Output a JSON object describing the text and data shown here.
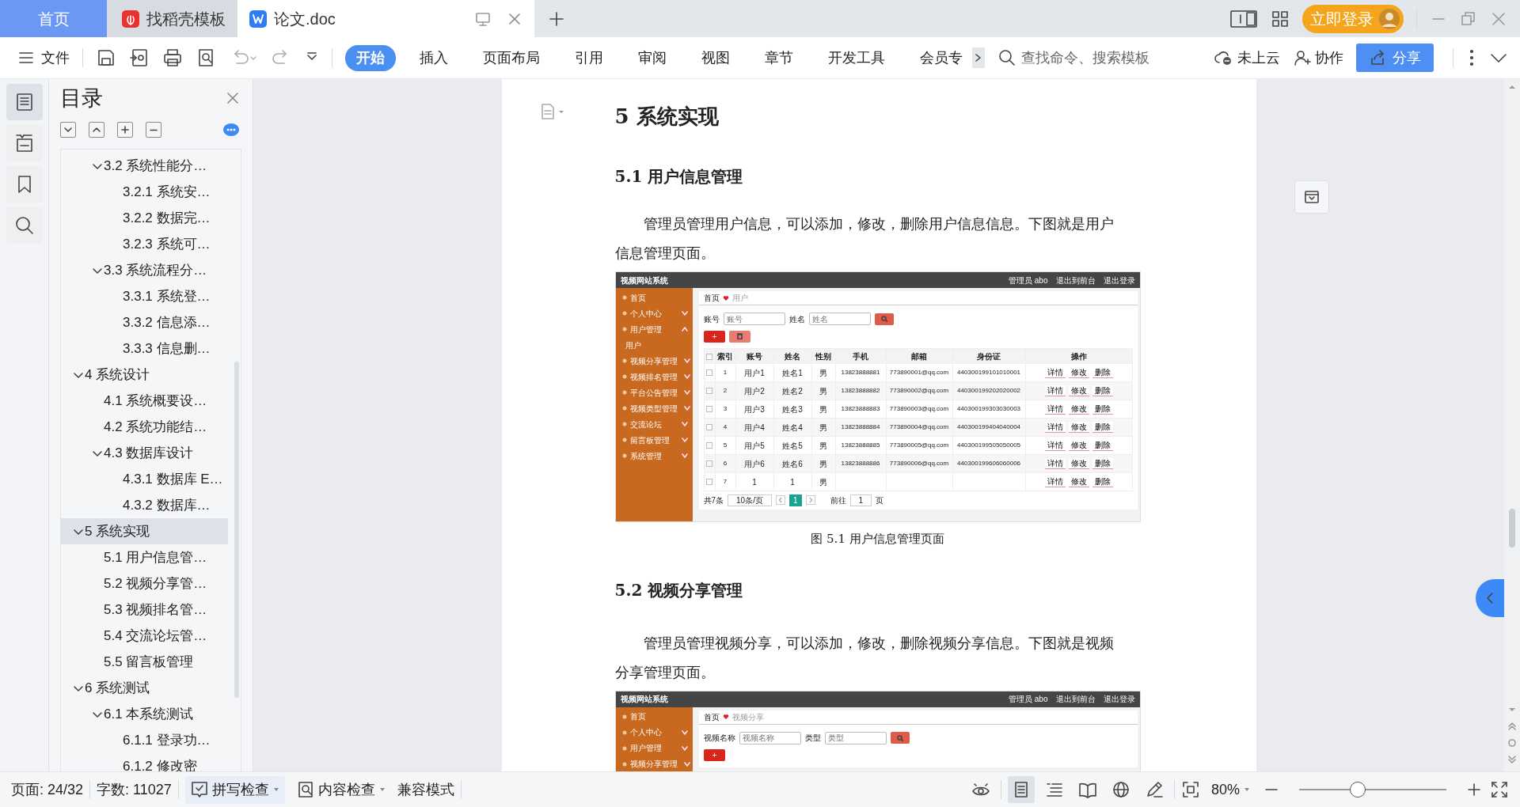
{
  "tabs": [
    {
      "label": "首页",
      "kind": "home",
      "selected": false
    },
    {
      "label": "找稻壳模板",
      "kind": "template",
      "selected": false
    },
    {
      "label": "论文.doc",
      "kind": "document",
      "selected": true
    }
  ],
  "login": "立即登录",
  "file_menu": "文件",
  "ribbon_tabs": [
    {
      "label": "开始",
      "selected": true
    },
    {
      "label": "插入",
      "selected": false
    },
    {
      "label": "页面布局",
      "selected": false
    },
    {
      "label": "引用",
      "selected": false
    },
    {
      "label": "审阅",
      "selected": false
    },
    {
      "label": "视图",
      "selected": false
    },
    {
      "label": "章节",
      "selected": false
    },
    {
      "label": "开发工具",
      "selected": false
    },
    {
      "label": "会员专",
      "selected": false
    }
  ],
  "search": {
    "placeholder": "查找命令、搜索模板"
  },
  "cloud": "未上云",
  "collaborate": "协作",
  "share": "分享",
  "rail": [
    {
      "kind": "toc",
      "selected": true
    },
    {
      "kind": "nav",
      "selected": false
    },
    {
      "kind": "bookmark",
      "selected": false
    },
    {
      "kind": "search",
      "selected": false
    }
  ],
  "toc": {
    "title": "目录",
    "items": [
      {
        "children": [
          {
            "label": "3.2 系统性能分…",
            "expanded": true,
            "selected": false,
            "children": [
              {
                "label": "3.2.1  系统安…",
                "selected": false
              },
              {
                "label": "3.2.2  数据完…",
                "selected": false
              },
              {
                "label": "3.2.3 系统可…",
                "selected": false
              }
            ]
          },
          {
            "label": "3.3 系统流程分…",
            "expanded": true,
            "selected": false,
            "children": [
              {
                "label": "3.3.1 系统登…",
                "selected": false
              },
              {
                "label": "3.3.2 信息添…",
                "selected": false
              },
              {
                "label": "3.3.3 信息删…",
                "selected": false
              }
            ]
          }
        ]
      },
      {
        "label": "4  系统设计",
        "expanded": true,
        "selected": false,
        "children": [
          {
            "label": "4.1 系统概要设…",
            "selected": false
          },
          {
            "label": "4.2 系统功能结…",
            "selected": false
          },
          {
            "label": "4.3 数据库设计",
            "expanded": true,
            "selected": false,
            "children": [
              {
                "label": "4.3.1 数据库 E…",
                "selected": false
              },
              {
                "label": "4.3.2  数据库…",
                "selected": false
              }
            ]
          }
        ]
      },
      {
        "label": "5  系统实现",
        "expanded": true,
        "selected": true,
        "children": [
          {
            "label": "5.1 用户信息管…",
            "selected": false
          },
          {
            "label": "5.2  视频分享管…",
            "selected": false
          },
          {
            "label": "5.3  视频排名管…",
            "selected": false
          },
          {
            "label": "5.4  交流论坛管…",
            "selected": false
          },
          {
            "label": "5.5 留言板管理",
            "selected": false
          }
        ]
      },
      {
        "label": "6 系统测试",
        "expanded": true,
        "selected": false,
        "children": [
          {
            "label": "6.1  本系统测试",
            "expanded": true,
            "selected": false,
            "children": [
              {
                "label": "6.1.1 登录功…",
                "selected": false
              },
              {
                "label": "6.1.2 修改密",
                "selected": false
              }
            ]
          }
        ]
      }
    ]
  },
  "document": {
    "heading": "5  系统实现",
    "sections": [
      {
        "heading": "5.1 用户信息管理",
        "paragraph": "管理员管理用户信息，可以添加，修改，删除用户信息信息。下图就是用户信息管理页面。",
        "caption": "图 5.1  用户信息管理页面",
        "app": {
          "title": "视频网站系统",
          "user": "管理员 abo",
          "links": [
            "退出到前台",
            "退出登录"
          ],
          "menu": [
            {
              "label": "首页",
              "kind": "link"
            },
            {
              "label": "个人中心",
              "kind": "group",
              "expanded": false
            },
            {
              "label": "用户管理",
              "kind": "group",
              "expanded": true
            },
            {
              "label": "用户",
              "kind": "sub"
            },
            {
              "label": "视频分享管理",
              "kind": "group",
              "expanded": false
            },
            {
              "label": "视频排名管理",
              "kind": "group",
              "expanded": false
            },
            {
              "label": "平台公告管理",
              "kind": "group",
              "expanded": false
            },
            {
              "label": "视频类型管理",
              "kind": "group",
              "expanded": false
            },
            {
              "label": "交流论坛",
              "kind": "group",
              "expanded": false
            },
            {
              "label": "留言板管理",
              "kind": "group",
              "expanded": false
            },
            {
              "label": "系统管理",
              "kind": "group",
              "expanded": false
            }
          ],
          "breadcrumb": [
            "首页",
            "用户"
          ],
          "filters": [
            {
              "label": "账号",
              "placeholder": "账号"
            },
            {
              "label": "姓名",
              "placeholder": "姓名"
            }
          ],
          "buttons": [
            {
              "kind": "add",
              "label": "+"
            },
            {
              "kind": "delete"
            }
          ],
          "table": {
            "all_checked": false,
            "columns": [
              "索引",
              "账号",
              "姓名",
              "性别",
              "手机",
              "邮箱",
              "身份证",
              "操作"
            ],
            "rows": [
              {
                "checked": false,
                "cells": [
                  "1",
                  "用户1",
                  "姓名1",
                  "男",
                  "13823888881",
                  "773890001@qq.com",
                  "440300199101010001"
                ],
                "actions": [
                  "详情",
                  "修改",
                  "删除"
                ]
              },
              {
                "checked": false,
                "cells": [
                  "2",
                  "用户2",
                  "姓名2",
                  "男",
                  "13823888882",
                  "773890002@qq.com",
                  "440300199202020002"
                ],
                "actions": [
                  "详情",
                  "修改",
                  "删除"
                ]
              },
              {
                "checked": false,
                "cells": [
                  "3",
                  "用户3",
                  "姓名3",
                  "男",
                  "13823888883",
                  "773890003@qq.com",
                  "440300199303030003"
                ],
                "actions": [
                  "详情",
                  "修改",
                  "删除"
                ]
              },
              {
                "checked": false,
                "cells": [
                  "4",
                  "用户4",
                  "姓名4",
                  "男",
                  "13823888884",
                  "773890004@qq.com",
                  "440300199404040004"
                ],
                "actions": [
                  "详情",
                  "修改",
                  "删除"
                ]
              },
              {
                "checked": false,
                "cells": [
                  "5",
                  "用户5",
                  "姓名5",
                  "男",
                  "13823888885",
                  "773890005@qq.com",
                  "440300199505050005"
                ],
                "actions": [
                  "详情",
                  "修改",
                  "删除"
                ]
              },
              {
                "checked": false,
                "cells": [
                  "6",
                  "用户6",
                  "姓名6",
                  "男",
                  "13823888886",
                  "773890006@qq.com",
                  "440300199606060006"
                ],
                "actions": [
                  "详情",
                  "修改",
                  "删除"
                ]
              },
              {
                "checked": false,
                "cells": [
                  "7",
                  "1",
                  "1",
                  "男"
                ],
                "actions": [
                  "详情",
                  "修改",
                  "删除"
                ]
              }
            ]
          },
          "pagination": {
            "total": "共7条",
            "size": "10条/页",
            "page": "1",
            "goto": "前往",
            "goto_value": "1",
            "unit": "页"
          }
        }
      },
      {
        "heading": "5.2  视频分享管理",
        "paragraph": "管理员管理视频分享，可以添加，修改，删除视频分享信息。下图就是视频分享管理页面。",
        "app": {
          "title": "视频网站系统",
          "user": "管理员 abo",
          "links": [
            "退出到前台",
            "退出登录"
          ],
          "menu": [
            {
              "label": "首页",
              "kind": "link"
            },
            {
              "label": "个人中心",
              "kind": "group",
              "expanded": false
            },
            {
              "label": "用户管理",
              "kind": "group",
              "expanded": false
            },
            {
              "label": "视频分享管理",
              "kind": "group",
              "expanded": false
            }
          ],
          "breadcrumb": [
            "首页",
            "视频分享"
          ],
          "filters": [
            {
              "label": "视频名称",
              "placeholder": "视频名称"
            },
            {
              "label": "类型",
              "placeholder": "类型"
            }
          ],
          "buttons": [
            {
              "kind": "add",
              "label": "+"
            }
          ]
        }
      }
    ]
  },
  "status_bar": {
    "page": "页面: 24/32",
    "words": "字数: 11027",
    "spell": "拼写检查",
    "content_check": "内容检查",
    "compat": "兼容模式",
    "views": [
      {
        "kind": "focus",
        "selected": false
      },
      {
        "kind": "page",
        "selected": true
      },
      {
        "kind": "outline",
        "selected": false
      },
      {
        "kind": "read",
        "selected": false
      },
      {
        "kind": "web",
        "selected": false
      },
      {
        "kind": "edit",
        "selected": false
      }
    ],
    "zoom": "80%",
    "zoom_slider": {
      "level": 0.4
    }
  }
}
